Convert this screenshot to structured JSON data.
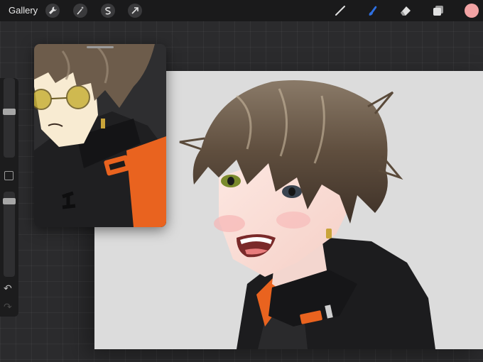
{
  "topbar": {
    "gallery_label": "Gallery",
    "left_tools": [
      "wrench-icon",
      "magic-wand-icon",
      "selection-icon",
      "transform-arrow-icon"
    ],
    "right_tools": [
      "brush-icon",
      "smudge-icon",
      "eraser-icon",
      "layers-icon"
    ],
    "active_tool": "smudge-icon",
    "active_color": "#f2a3a4",
    "accent": "#2e6fe0"
  },
  "sidebar": {
    "brush_size_level": 0.5,
    "opacity_level": 0.95,
    "undo_icon": "undo-icon",
    "redo_icon": "redo-icon"
  },
  "reference_window": {
    "subject": "reference-image"
  }
}
